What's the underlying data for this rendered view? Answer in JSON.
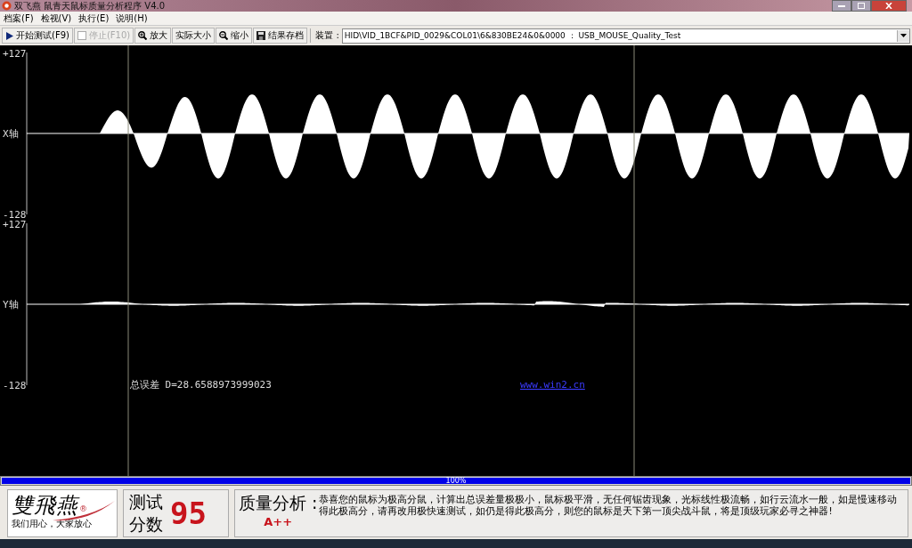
{
  "window": {
    "title": "双飞燕 鼠青天鼠标质量分析程序 V4.0"
  },
  "menu": [
    {
      "label": "档案(F)"
    },
    {
      "label": "检视(V)"
    },
    {
      "label": "执行(E)"
    },
    {
      "label": "说明(H)"
    }
  ],
  "toolbar": [
    {
      "kind": "play",
      "label": "开始测试(F9)",
      "disabled": false
    },
    {
      "kind": "checkbox",
      "label": "停止(F10)",
      "disabled": true,
      "checked": false
    },
    {
      "kind": "zoom-in",
      "label": "放大",
      "disabled": false
    },
    {
      "kind": "plain",
      "label": "实际大小",
      "disabled": false
    },
    {
      "kind": "zoom-out",
      "label": "缩小",
      "disabled": false
    },
    {
      "kind": "save",
      "label": "结果存档",
      "disabled": false
    }
  ],
  "device": {
    "label": "装置 :",
    "value": "HID\\VID_1BCF&PID_0029&COL01\\6&830BE24&0&0000 ： USB_MOUSE_Quality_Test"
  },
  "plot": {
    "channels": [
      {
        "label": "X轴",
        "max": "+127",
        "min": "-128"
      },
      {
        "label": "Y轴",
        "max": "+127",
        "min": "-128"
      }
    ],
    "error_text": "总误差 D=28.6588973999023",
    "link": "www.win2.cn"
  },
  "progress": {
    "level": 1,
    "reading": "100%"
  },
  "logo": {
    "brand": "雙飛燕",
    "mark": "®",
    "tagline": "我们用心，大家放心"
  },
  "score": {
    "label_1": "测试",
    "label_2": "分数",
    "value": "95"
  },
  "analysis": {
    "label": "质量分析 :",
    "text": "恭喜您的鼠标为极高分鼠，计算出总误差量极极小，鼠标极平滑，无任何锯齿现象，光标线性极流畅，如行云流水一般，如是慢速移动得此极高分，请再改用极快速测试，如仍是得此极高分，则您的鼠标是天下第一顶尖战斗鼠，将是顶级玩家必寻之神器!",
    "grade": "A++"
  }
}
